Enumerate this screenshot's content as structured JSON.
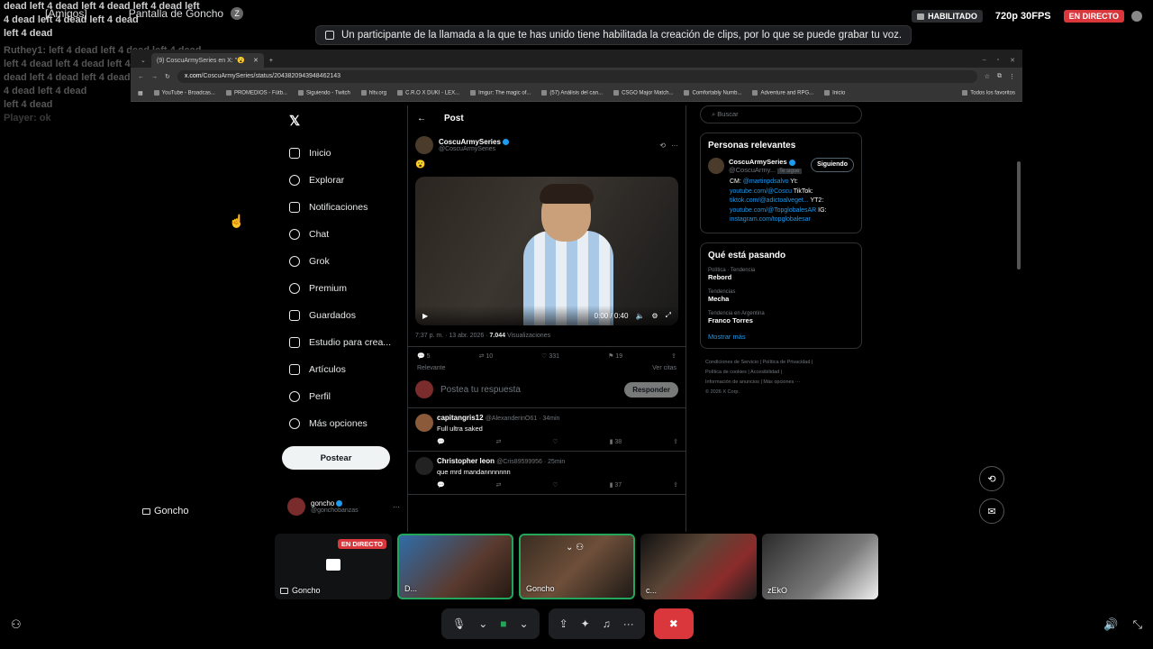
{
  "overlay": {
    "group": "[Amigos]",
    "channel": "Pantalla de Goncho",
    "chat_lines": [
      "dead left 4 dead left 4 dead left 4 dead left",
      "4 dead left 4 dead left 4 dead",
      "left 4 dead"
    ],
    "faded_lines": [
      "Ruthey1: left 4 dead left 4 dead left 4 dead",
      "left 4 dead left 4 dead left 4 dead",
      "dead left 4 dead left 4 dead",
      "4 dead left 4 dead",
      "left 4 dead"
    ],
    "faded_last": "Player: ok"
  },
  "status": {
    "enabled": "HABILITADO",
    "quality": "720p 30FPS",
    "live": "EN DIRECTO"
  },
  "notice": "Un participante de la llamada a la que te has unido tiene habilitada la creación de clips, por lo que se puede grabar tu voz.",
  "browser": {
    "tab_title": "(9) CoscuArmySeries en X: \"😮",
    "url_host": "x.com",
    "url_path": "/CoscuArmySeries/status/2043820943948462143",
    "bookmarks": [
      "YouTube - Broadcas...",
      "PROMEDIOS - Fútb...",
      "Siguiendo - Twitch",
      "hltv.org",
      "C.R.O X DUKI - LEX...",
      "Imgur: The magic of...",
      "(57) Análisis del can...",
      "CSGO Major Match...",
      "Comfortably Numb...",
      "Adventure and RPG...",
      "Inicio"
    ],
    "all_favs": "Todos los favoritos"
  },
  "nav": {
    "items": [
      "Inicio",
      "Explorar",
      "Notificaciones",
      "Chat",
      "Grok",
      "Premium",
      "Guardados",
      "Estudio para crea...",
      "Artículos",
      "Perfil",
      "Más opciones"
    ],
    "post_button": "Postear",
    "profile_name": "goncho",
    "profile_handle": "@gonchobanzas"
  },
  "post": {
    "header": "Post",
    "author": "CoscuArmySeries",
    "handle": "@CoscuArmySeries",
    "emoji": "😮",
    "video_time": "0:00 / 0:40",
    "meta_time": "7:37 p. m. · 13 abr. 2026 · ",
    "views": "7.044",
    "views_label": " Visualizaciones",
    "replies": "5",
    "reposts": "10",
    "likes": "331",
    "bookmarks": "19",
    "sort": "Relevante",
    "quotes": "Ver citas",
    "reply_placeholder": "Postea tu respuesta",
    "reply_button": "Responder"
  },
  "comments": [
    {
      "name": "capitangris12",
      "meta": "@AlexanderinO61 · 34min",
      "text": "Full ultra saked",
      "views": "38"
    },
    {
      "name": "Christopher leon",
      "meta": "@Cris89599956 · 25min",
      "text": "que mrd mandannnnnnn",
      "views": "37"
    }
  ],
  "side": {
    "search": "Buscar",
    "relevant_title": "Personas relevantes",
    "rel_name": "CoscuArmySeries",
    "rel_handle": "@CoscuArmy...",
    "rel_tag": "Te sigue",
    "follow": "Siguiendo",
    "bio1": "CM: ",
    "bio1_link": "@martinpdsalvo",
    "bio1b": " Yt:",
    "bio2_link": "youtube.com/@Coscu",
    "bio2b": " TikTok:",
    "bio3_link": "tiktok.com/@adictoalveget...",
    "bio3b": " YT2:",
    "bio4_link": "youtube.com/@TopglobalesAR",
    "bio4b": " IG:",
    "bio5_link": "instagram.com/topglobalesar",
    "happening_title": "Qué está pasando",
    "trends": [
      {
        "cat": "Política · Tendencia",
        "title": "Rebord"
      },
      {
        "cat": "Tendencias",
        "title": "Mecha"
      },
      {
        "cat": "Tendencia en Argentina",
        "title": "Franco Torres"
      }
    ],
    "show_more": "Mostrar más",
    "footer1": "Condiciones de Servicio  |  Política de Privacidad  |",
    "footer2": "Política de cookies  |  Accesibilidad  |",
    "footer3": "Información de anuncios  |  Más opciones ···",
    "footer4": "© 2026 X Corp."
  },
  "screen_label": "Goncho",
  "tiles": [
    {
      "name": "Goncho",
      "live": "EN DIRECTO"
    },
    {
      "name": "D..."
    },
    {
      "name": "Goncho"
    },
    {
      "name": "c..."
    },
    {
      "name": "zEkO"
    }
  ]
}
